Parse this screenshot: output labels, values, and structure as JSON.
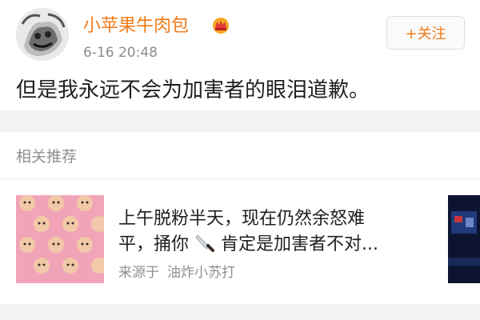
{
  "post": {
    "username": "小苹果牛肉包",
    "timestamp": "6-16 20:48",
    "follow_label": "+关注",
    "text": "但是我永远不会为加害者的眼泪道歉。",
    "vip_badge_icon": "crown-badge-icon"
  },
  "recommend": {
    "title": "相关推荐",
    "item": {
      "line1": "上午脱粉半天，现在仍然余怒难",
      "line2_before": "平，捅你",
      "line2_icon": "knife-emoji-icon",
      "line2_after": "肯定是加害者不对...",
      "source_label": "来源于",
      "source_name": "油炸小苏打"
    }
  },
  "colors": {
    "accent": "#f07a17",
    "text": "#1f1f1f",
    "muted": "#8f8f8f",
    "background": "#f2f2f2"
  }
}
